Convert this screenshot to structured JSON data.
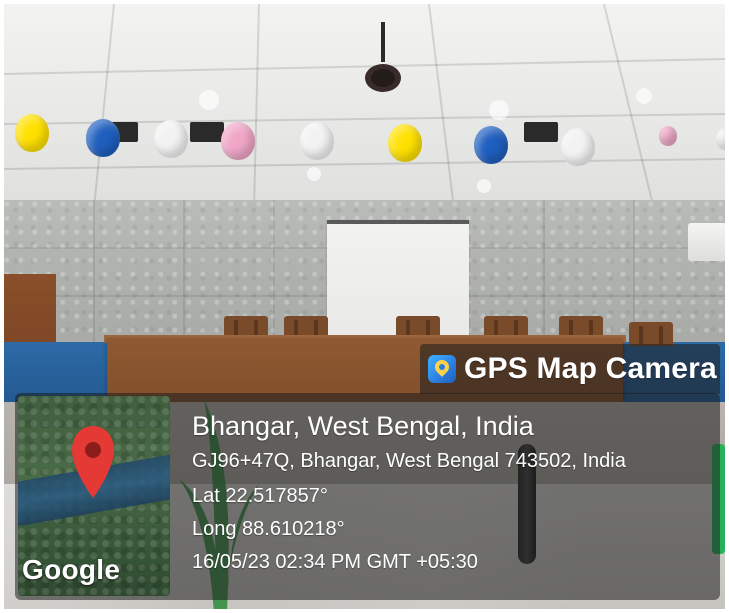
{
  "overlay": {
    "app_title": "GPS Map Camera",
    "app_icon": "gps-map-camera-app-icon",
    "location_title": "Bhangar, West Bengal, India",
    "address": "GJ96+47Q, Bhangar, West Bengal 743502, India",
    "latitude": "Lat 22.517857°",
    "longitude": "Long 88.610218°",
    "datetime": "16/05/23 02:34 PM GMT +05:30",
    "map": {
      "provider_label": "Google",
      "pin_icon": "map-pin-icon"
    }
  },
  "colors": {
    "overlay_bg": "#1e1e1e",
    "pin_red": "#e53935",
    "app_icon_blue": "#2c7de0",
    "app_icon_yellow": "#ffd24a",
    "balloon_yellow": "#ffe100",
    "balloon_blue": "#1f5fbf",
    "balloon_pink": "#f0a6c7",
    "balloon_white": "#f2f2f2"
  }
}
